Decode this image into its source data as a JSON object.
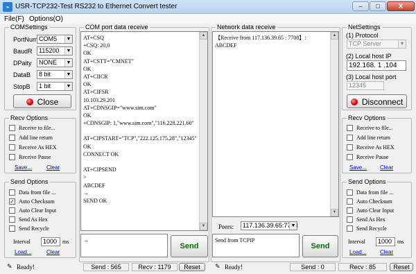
{
  "window": {
    "title": "USR-TCP232-Test  RS232 to Ethernet Convert tester",
    "minimize": "–",
    "maximize": "□",
    "close": "X"
  },
  "menu": {
    "file": "File(F)",
    "options": "Options(O)"
  },
  "com_settings": {
    "legend": "COMSettings",
    "port_label": "PortNum",
    "port_value": "COM5",
    "baud_label": "BaudR",
    "baud_value": "115200",
    "parity_label": "DPaity",
    "parity_value": "NONE",
    "databits_label": "DataB",
    "databits_value": "8 bit",
    "stopbits_label": "StopB",
    "stopbits_value": "1 bit",
    "close_button": "Close"
  },
  "left_recv_options": {
    "legend": "Recv Options",
    "items": [
      {
        "label": "Receive to file...",
        "checked": false
      },
      {
        "label": "Add line return",
        "checked": false
      },
      {
        "label": "Receive As HEX",
        "checked": false
      },
      {
        "label": "Receive Pause",
        "checked": false
      }
    ],
    "save": "Save...",
    "clear": "Clear"
  },
  "left_send_options": {
    "legend": "Send Options",
    "items": [
      {
        "label": "Data from file ...",
        "checked": false
      },
      {
        "label": "Auto Checksum",
        "checked": true
      },
      {
        "label": "Auto Clear Input",
        "checked": false
      },
      {
        "label": "Send As Hex",
        "checked": false
      },
      {
        "label": "Send Recycle",
        "checked": false
      }
    ],
    "interval_label": "Interval",
    "interval_value": "1000",
    "interval_unit": "ms",
    "load": "Load...",
    "clear": "Clear"
  },
  "com_port_data": {
    "legend": "COM port data receive",
    "lines": [
      "AT+CSQ",
      "+CSQ: 20,0",
      "OK",
      "AT+CSTT=\"CMNET\"",
      "OK",
      "AT+CIICR",
      "OK",
      "AT+CIFSR",
      "10.103.29.201",
      "AT+CDNSGIP=\"www.sim.com\"",
      "OK",
      "+CDNSGIP: 1,\"www.sim.com\",\"116.228.221.60\"",
      "",
      "AT+CIPSTART=\"TCP\",\"222.125.175.28\",\"12345\"",
      "OK",
      "CONNECT OK",
      "",
      "AT+CIPSEND",
      ">",
      "ABCDEF",
      "→",
      "SEND OK"
    ],
    "send_input": "→",
    "send_button": "Send"
  },
  "network_data": {
    "legend": "Network data receive",
    "lines": [
      "【Receive from 117.136.39.65 : 7708】:",
      "ABCDEF"
    ],
    "peers_label": "Peers:",
    "peers_value": "117.136.39.65:7708",
    "send_input": "Send from TCPIP",
    "send_button": "Send"
  },
  "net_settings": {
    "legend": "NetSettings",
    "protocol_label": "(1) Protocol",
    "protocol_value": "TCP Server",
    "host_ip_label": "(2) Local host IP",
    "host_ip_value": "192.168. 1 .104",
    "host_port_label": "(3) Local host port",
    "host_port_value": "12345",
    "disconnect_button": "Disconnect"
  },
  "right_recv_options": {
    "legend": "Recv Options",
    "items": [
      {
        "label": "Receive to file...",
        "checked": false
      },
      {
        "label": "Add line return",
        "checked": false
      },
      {
        "label": "Receive As HEX",
        "checked": false
      },
      {
        "label": "Receive Pause",
        "checked": false
      }
    ],
    "save": "Save...",
    "clear": "Clear"
  },
  "right_send_options": {
    "legend": "Send Options",
    "items": [
      {
        "label": "Data from file ...",
        "checked": false
      },
      {
        "label": "Auto Checksum",
        "checked": false
      },
      {
        "label": "Auto Clear Input",
        "checked": false
      },
      {
        "label": "Send As Hex",
        "checked": false
      },
      {
        "label": "Send Recycle",
        "checked": false
      }
    ],
    "interval_label": "Interval",
    "interval_value": "1000",
    "interval_unit": "ms",
    "load": "Load...",
    "clear": "Clear"
  },
  "status_left": {
    "ready": "Ready!",
    "send": "Send : 565",
    "recv": "Recv : 1179",
    "reset": "Reset"
  },
  "status_right": {
    "ready": "Ready!",
    "send": "Send : 0",
    "recv": "Recv : 85",
    "reset": "Reset"
  }
}
